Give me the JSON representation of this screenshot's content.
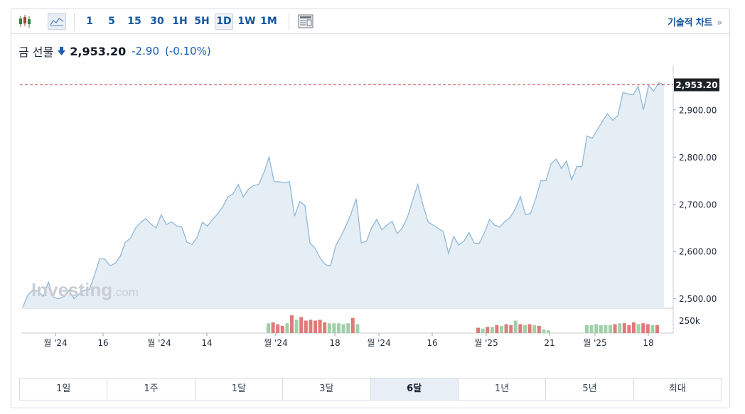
{
  "toolbar": {
    "chart_type_icons": [
      "candlestick-icon",
      "area-chart-icon"
    ],
    "timeframes": [
      "1",
      "5",
      "15",
      "30",
      "1H",
      "5H",
      "1D",
      "1W",
      "1M"
    ],
    "active_timeframe": "1D",
    "settings_icon": "chart-layout-icon",
    "technical_chart_label": "기술적 차트",
    "technical_chart_chevron": "»"
  },
  "header": {
    "instrument": "금 선물",
    "direction_icon": "arrow-down-icon",
    "last": "2,953.20",
    "change": "-2.90",
    "change_pct": "(-0.10%)"
  },
  "watermark": {
    "brand": "Investing",
    "suffix": ".com"
  },
  "colors": {
    "line": "#8fb8d8",
    "area": "#e6eef5",
    "price_line": "#c0392b",
    "vol_up": "#9fd0a8",
    "vol_down": "#e07a7a",
    "accent": "#1256a0"
  },
  "chart_data": {
    "type": "area",
    "ylim": [
      2480,
      2990
    ],
    "yticks": [
      {
        "value": 2900,
        "label": "2,900.00"
      },
      {
        "value": 2800,
        "label": "2,800.00"
      },
      {
        "value": 2700,
        "label": "2,700.00"
      },
      {
        "value": 2600,
        "label": "2,600.00"
      },
      {
        "value": 2500,
        "label": "2,500.00"
      }
    ],
    "current_price": {
      "value": 2953.2,
      "label": "2,953.20"
    },
    "volume_label": "250k",
    "xticks": [
      "월 '24",
      "16",
      "월 '24",
      "14",
      "월 '24",
      "18",
      "월 '24",
      "16",
      "월 '25",
      "21",
      "월 '25",
      "18"
    ],
    "series": [
      {
        "values": [
          2482,
          2508,
          2518,
          2516,
          2505,
          2535,
          2503,
          2500,
          2504,
          2518,
          2500,
          2510,
          2518,
          2520,
          2550,
          2585,
          2584,
          2570,
          2575,
          2590,
          2620,
          2628,
          2650,
          2662,
          2670,
          2658,
          2650,
          2678,
          2657,
          2663,
          2654,
          2652,
          2620,
          2615,
          2630,
          2662,
          2654,
          2668,
          2680,
          2695,
          2716,
          2722,
          2742,
          2716,
          2732,
          2740,
          2742,
          2767,
          2800,
          2748,
          2748,
          2746,
          2748,
          2675,
          2706,
          2698,
          2618,
          2607,
          2586,
          2572,
          2570,
          2612,
          2632,
          2654,
          2680,
          2712,
          2618,
          2622,
          2650,
          2668,
          2646,
          2656,
          2664,
          2638,
          2650,
          2673,
          2708,
          2742,
          2700,
          2663,
          2656,
          2649,
          2642,
          2596,
          2632,
          2614,
          2622,
          2640,
          2618,
          2617,
          2640,
          2668,
          2656,
          2652,
          2664,
          2672,
          2690,
          2716,
          2678,
          2681,
          2712,
          2750,
          2750,
          2786,
          2796,
          2776,
          2792,
          2752,
          2780,
          2780,
          2845,
          2840,
          2858,
          2876,
          2892,
          2878,
          2888,
          2937,
          2934,
          2932,
          2950,
          2900,
          2952,
          2940,
          2958,
          2953.2
        ]
      }
    ],
    "volume": [
      {
        "v": 0.55,
        "dir": "up"
      },
      {
        "v": 0.6,
        "dir": "down"
      },
      {
        "v": 0.5,
        "dir": "down"
      },
      {
        "v": 0.4,
        "dir": "down"
      },
      {
        "v": 0.55,
        "dir": "up"
      },
      {
        "v": 1.0,
        "dir": "down"
      },
      {
        "v": 0.75,
        "dir": "up"
      },
      {
        "v": 0.9,
        "dir": "down"
      },
      {
        "v": 0.7,
        "dir": "down"
      },
      {
        "v": 0.75,
        "dir": "down"
      },
      {
        "v": 0.7,
        "dir": "down"
      },
      {
        "v": 0.75,
        "dir": "down"
      },
      {
        "v": 0.6,
        "dir": "down"
      },
      {
        "v": 0.55,
        "dir": "up"
      },
      {
        "v": 0.55,
        "dir": "up"
      },
      {
        "v": 0.55,
        "dir": "up"
      },
      {
        "v": 0.5,
        "dir": "up"
      },
      {
        "v": 0.55,
        "dir": "up"
      },
      {
        "v": 0.85,
        "dir": "down"
      },
      {
        "v": 0.5,
        "dir": "up"
      },
      {
        "v": 0.3,
        "dir": "down"
      },
      {
        "v": 0.25,
        "dir": "up"
      },
      {
        "v": 0.35,
        "dir": "down"
      },
      {
        "v": 0.35,
        "dir": "up"
      },
      {
        "v": 0.45,
        "dir": "down"
      },
      {
        "v": 0.4,
        "dir": "up"
      },
      {
        "v": 0.5,
        "dir": "down"
      },
      {
        "v": 0.45,
        "dir": "down"
      },
      {
        "v": 0.7,
        "dir": "up"
      },
      {
        "v": 0.5,
        "dir": "down"
      },
      {
        "v": 0.45,
        "dir": "up"
      },
      {
        "v": 0.5,
        "dir": "down"
      },
      {
        "v": 0.45,
        "dir": "up"
      },
      {
        "v": 0.4,
        "dir": "down"
      },
      {
        "v": 0.2,
        "dir": "up"
      },
      {
        "v": 0.15,
        "dir": "up"
      },
      {
        "v": 0.45,
        "dir": "up"
      },
      {
        "v": 0.45,
        "dir": "up"
      },
      {
        "v": 0.5,
        "dir": "up"
      },
      {
        "v": 0.45,
        "dir": "up"
      },
      {
        "v": 0.45,
        "dir": "up"
      },
      {
        "v": 0.45,
        "dir": "up"
      },
      {
        "v": 0.5,
        "dir": "down"
      },
      {
        "v": 0.55,
        "dir": "up"
      },
      {
        "v": 0.55,
        "dir": "down"
      },
      {
        "v": 0.45,
        "dir": "down"
      },
      {
        "v": 0.6,
        "dir": "down"
      },
      {
        "v": 0.5,
        "dir": "up"
      },
      {
        "v": 0.55,
        "dir": "down"
      },
      {
        "v": 0.5,
        "dir": "down"
      },
      {
        "v": 0.45,
        "dir": "up"
      },
      {
        "v": 0.45,
        "dir": "down"
      }
    ]
  },
  "ranges": {
    "items": [
      "1일",
      "1주",
      "1달",
      "3달",
      "6달",
      "1년",
      "5년",
      "최대"
    ],
    "active": "6달"
  }
}
